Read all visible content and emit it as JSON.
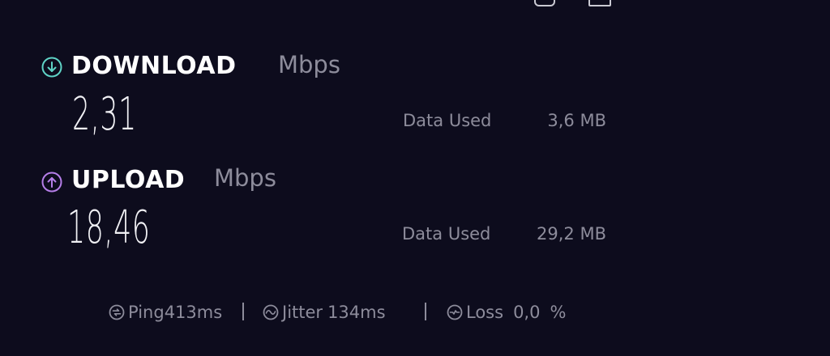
{
  "download": {
    "title": "DOWNLOAD",
    "unit": "Mbps",
    "speed": "2,31",
    "data_used_label": "Data Used",
    "data_used_value": "3,6 MB"
  },
  "upload": {
    "title": "UPLOAD",
    "unit": "Mbps",
    "speed": "18,46",
    "data_used_label": "Data Used",
    "data_used_value": "29,2 MB"
  },
  "metrics": {
    "ping_label": "Ping",
    "ping_value": "413",
    "ping_unit": "ms",
    "jitter_label": "Jitter",
    "jitter_value": "134",
    "jitter_unit": "ms",
    "loss_label": "Loss",
    "loss_value": "0,0",
    "loss_unit": "%"
  },
  "colors": {
    "background": "#0d0c1d",
    "download_accent": "#5fd3c6",
    "upload_accent": "#b57ee8",
    "muted_text": "#8d8c9b"
  },
  "icons": {
    "download": "arrow-down-circle-icon",
    "upload": "arrow-up-circle-icon",
    "ping": "ping-icon",
    "jitter": "jitter-icon",
    "loss": "loss-icon"
  }
}
